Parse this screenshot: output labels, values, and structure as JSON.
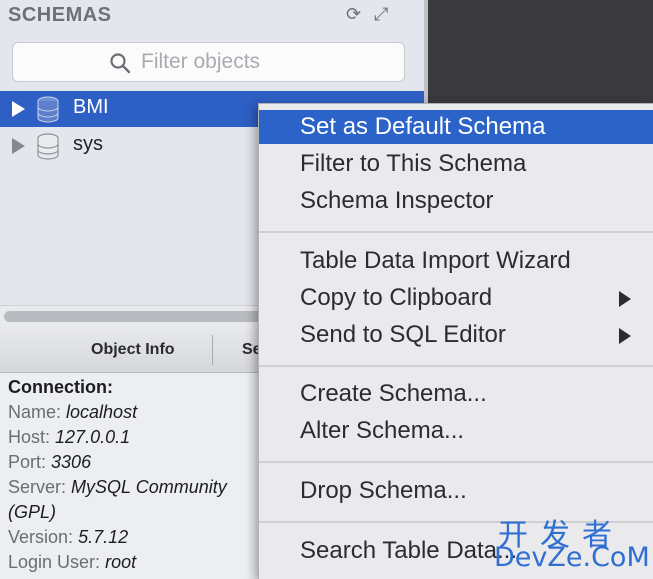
{
  "schemas_panel": {
    "title": "SCHEMAS",
    "refresh_icon": "refresh-icon",
    "expand_icon": "expand-icon",
    "filter": {
      "placeholder": "Filter objects",
      "icon": "search-icon"
    },
    "items": [
      {
        "label": "BMI",
        "selected": true,
        "icon": "database-icon"
      },
      {
        "label": "sys",
        "selected": false,
        "icon": "database-icon"
      }
    ]
  },
  "info_panel": {
    "tabs": [
      "Object Info",
      "Se"
    ],
    "heading": "Connection:",
    "fields": [
      {
        "label": "Name:",
        "value": "localhost"
      },
      {
        "label": "Host:",
        "value": "127.0.0.1"
      },
      {
        "label": "Port:",
        "value": "3306"
      },
      {
        "label": "Server:",
        "value": "MySQL Community"
      },
      {
        "label": "",
        "value": "(GPL)"
      },
      {
        "label": "Version:",
        "value": "5.7.12"
      },
      {
        "label": "Login User:",
        "value": "root"
      }
    ]
  },
  "context_menu": {
    "items": [
      {
        "label": "Set as Default Schema",
        "active": true
      },
      {
        "label": "Filter to This Schema"
      },
      {
        "label": "Schema Inspector"
      },
      {
        "label": "Table Data Import Wizard"
      },
      {
        "label": "Copy to Clipboard",
        "submenu": true
      },
      {
        "label": "Send to SQL Editor",
        "submenu": true
      },
      {
        "label": "Create Schema..."
      },
      {
        "label": "Alter Schema..."
      },
      {
        "label": "Drop Schema..."
      },
      {
        "label": "Search Table Data..."
      }
    ]
  },
  "watermark": {
    "line1": "开发者",
    "line2": "DevZe.CoM"
  },
  "colors": {
    "selection": "#2e5fc4",
    "menu_bg": "#eaeaec",
    "panel_bg": "#e3e6ec"
  }
}
